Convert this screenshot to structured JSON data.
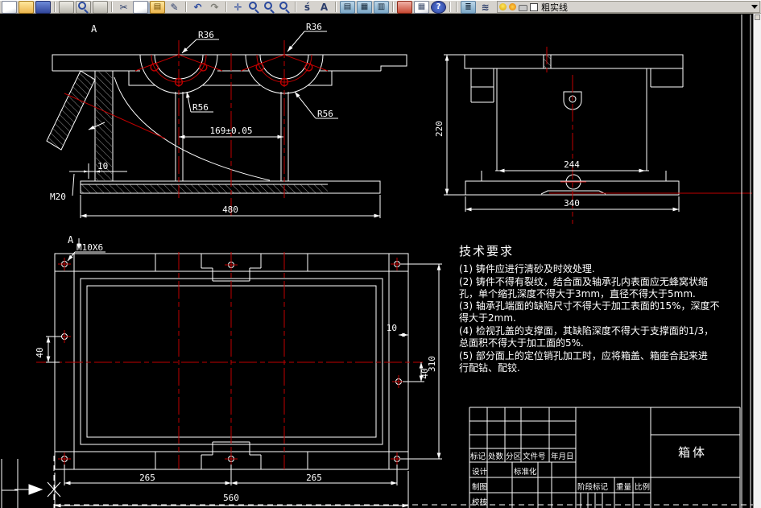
{
  "app": {
    "canvas_bg": "#000000",
    "toolbar_bg": "#d6d3ce",
    "line_color": "#ffffff",
    "accent_red": "#c00000"
  },
  "toolbar": {
    "icons": [
      "new-icon",
      "open-icon",
      "save-icon",
      "plot-icon",
      "plot-preview-icon",
      "publish-icon",
      "cut-icon",
      "copy-icon",
      "paste-icon",
      "match-properties-icon",
      "undo-icon",
      "redo-icon",
      "pan-icon",
      "zoom-realtime-icon",
      "zoom-window-icon",
      "zoom-previous-icon",
      "spell-icon",
      "text-style-icon",
      "properties-icon",
      "design-center-icon",
      "tool-palettes-icon",
      "table-icon",
      "publish-pdf-icon",
      "help-icon",
      "layer-properties-icon",
      "layer-states-icon",
      "layer-on-icon",
      "layer-freeze-icon",
      "layer-lock-icon",
      "layer-color-swatch"
    ],
    "layer_combo": {
      "value": "粗实线"
    }
  },
  "front_view": {
    "section_label": "A",
    "r36_left": "R36",
    "r36_right": "R36",
    "r56_left": "R56",
    "r56_right": "R56",
    "center_distance": "169±0.05",
    "overall_width": "480",
    "wall_offset": "10",
    "drain_thread": "M20"
  },
  "side_view": {
    "height": "220",
    "body_width": "244",
    "base_width": "340"
  },
  "top_view": {
    "section_label": "A",
    "tap_label": "M10X6",
    "hole_offset_left": "40",
    "edge_offset": "10",
    "hole_offset_right": "40",
    "overall_depth": "310",
    "hole_pitch_left": "265",
    "hole_pitch_right": "265",
    "overall_width": "560"
  },
  "tech_requirements": {
    "title": "技术要求",
    "lines": [
      "(1) 铸件应进行清砂及时效处理.",
      "(2) 铸件不得有裂纹，结合面及轴承孔内表面应无蜂窝状缩",
      "孔，单个缩孔深度不得大于3mm，直径不得大于5mm.",
      "(3) 轴承孔端面的缺陷尺寸不得大于加工表面的15%，深度不",
      "得大于2mm.",
      "(4) 检视孔盖的支撑面，其缺陷深度不得大于支撑面的1/3，",
      "总面积不得大于加工面的5%.",
      "(5) 部分面上的定位销孔加工时，应将箱盖、箱座合起来进",
      "行配钻、配铰."
    ]
  },
  "title_block": {
    "part_name": "箱体",
    "rev_headers": [
      "标记",
      "处数",
      "分区",
      "文件号",
      "年月日"
    ],
    "design_label": "设计",
    "std_label": "标准化",
    "draft_label": "制图",
    "check_label": "校核",
    "stage_label": "阶段标记",
    "weight_label": "重量",
    "scale_label": "比例"
  }
}
